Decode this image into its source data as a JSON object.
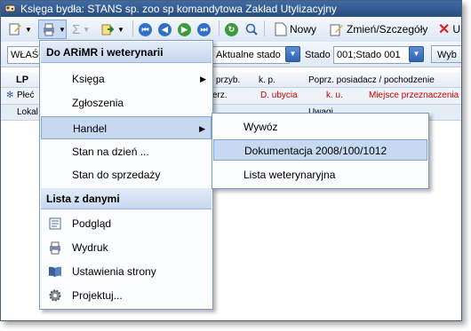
{
  "window": {
    "title": "Księga bydła: STANS sp. zoo sp komandytowa Zakład Utylizacyjny"
  },
  "toolbar1": {
    "nowy_label": "Nowy",
    "zmien_label": "Zmień/Szczegóły",
    "usun_label": "U"
  },
  "toolbar2": {
    "owner_combo_value": "WŁAŚC",
    "herd_type_value": "Aktualne stado",
    "herd_label": "Stado",
    "herd_value": "001;Stado 001",
    "choose_label": "Wyb"
  },
  "grid": {
    "headers_row1": [
      "LP",
      "przyb.",
      "k. p.",
      "Poprz. posiadacz / pochodzenie"
    ],
    "headers_row2": [
      "Płeć",
      "erz.",
      "D. ubycia",
      "k. u.",
      "Miejsce przeznaczenia"
    ],
    "headers_row3": [
      "Lokal",
      "Uwagi"
    ]
  },
  "menu": {
    "section1_title": "Do ARiMR i weterynarii",
    "items1": [
      "Księga",
      "Zgłoszenia",
      "Handel",
      "Stan na dzień ...",
      "Stan do sprzedaży"
    ],
    "section2_title": "Lista z danymi",
    "items2": [
      "Podgląd",
      "Wydruk",
      "Ustawienia strony",
      "Projektuj..."
    ]
  },
  "submenu": {
    "items": [
      "Wywóz",
      "Dokumentacja 2008/100/1012",
      "Lista weterynaryjna"
    ]
  },
  "colors": {
    "title_bar": "#2f5a92",
    "menu_highlight": "#c7d9f1",
    "red_header_text": "#cc0000"
  }
}
